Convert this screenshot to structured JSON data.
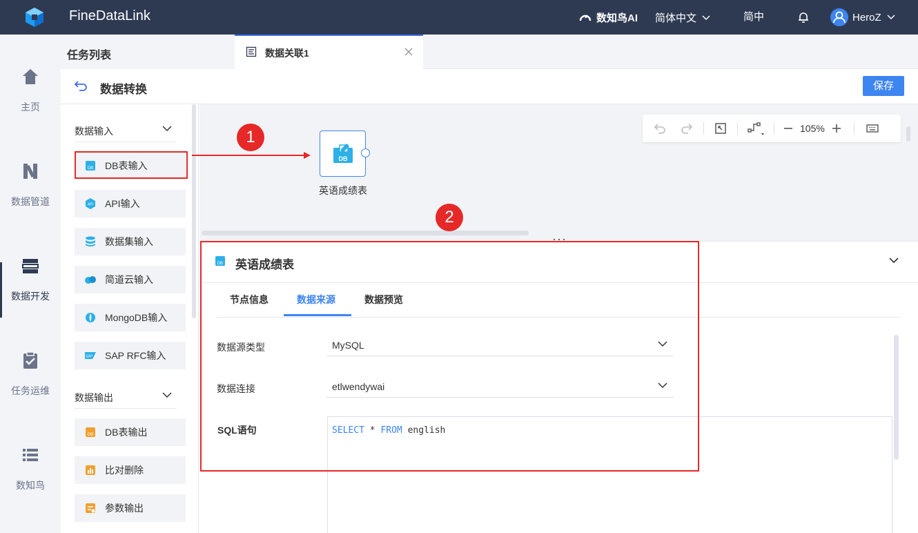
{
  "topbar": {
    "app_title": "FineDataLink",
    "ai_label": "数知鸟AI",
    "language": "简体中文",
    "locale_short": "简中",
    "username": "HeroZ"
  },
  "leftnav": {
    "items": [
      {
        "label": "主页",
        "icon": "home-icon"
      },
      {
        "label": "数据管道",
        "icon": "pipeline-icon"
      },
      {
        "label": "数据开发",
        "icon": "dev-icon"
      },
      {
        "label": "任务运维",
        "icon": "task-ops-icon"
      },
      {
        "label": "数知鸟",
        "icon": "list-icon"
      }
    ],
    "active": "数据开发"
  },
  "tasklist": {
    "title": "任务列表"
  },
  "tab": {
    "label": "数据关联1"
  },
  "subheader": {
    "title": "数据转换",
    "save_label": "保存"
  },
  "components": {
    "input_group": "数据输入",
    "input_items": [
      "DB表输入",
      "API输入",
      "数据集输入",
      "简道云输入",
      "MongoDB输入",
      "SAP RFC输入"
    ],
    "output_group": "数据输出",
    "output_items": [
      "DB表输出",
      "比对删除",
      "参数输出"
    ]
  },
  "canvas": {
    "zoom": "105%",
    "node_label": "英语成绩表",
    "node_icon_text": "DB"
  },
  "annotations": {
    "badge1": "1",
    "badge2": "2"
  },
  "properties": {
    "title": "英语成绩表",
    "tabs": [
      "节点信息",
      "数据来源",
      "数据预览"
    ],
    "active_tab": "数据来源",
    "source_type_label": "数据源类型",
    "source_type_value": "MySQL",
    "connection_label": "数据连接",
    "connection_value": "etlwendywai",
    "sql_label": "SQL语句",
    "sql": {
      "kw1": "SELECT",
      "mid": " * ",
      "kw2": "FROM",
      "rest": " english"
    }
  },
  "colors": {
    "topbar": "#2e3a52",
    "accent": "#3d85f0",
    "highlight": "#e62828"
  }
}
